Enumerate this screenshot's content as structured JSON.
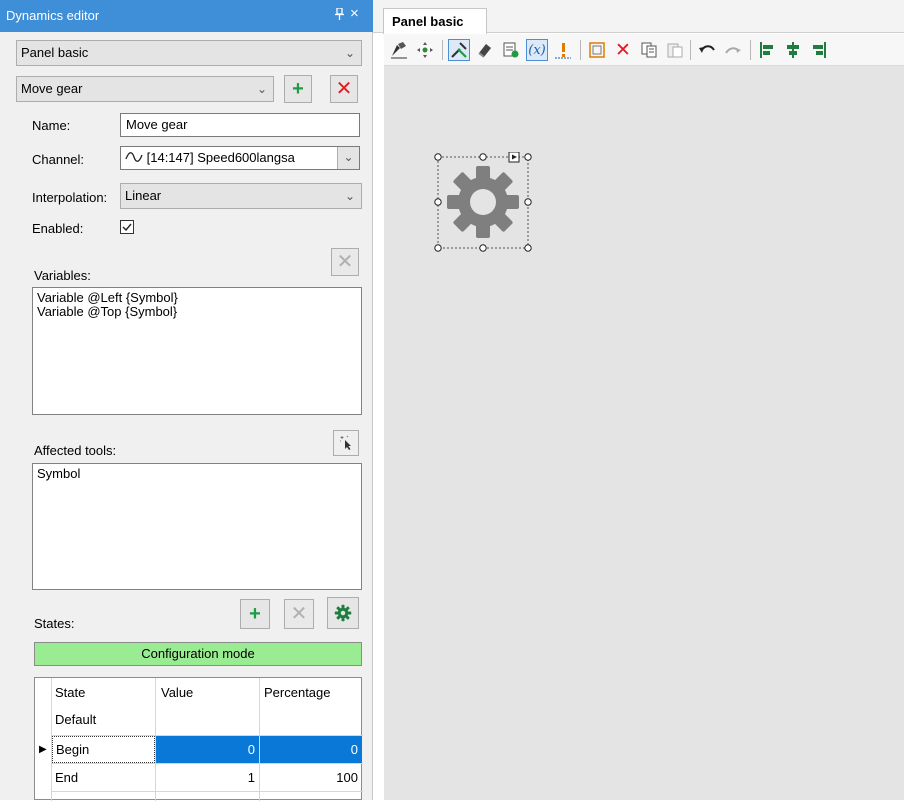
{
  "panel": {
    "title": "Dynamics editor",
    "pin_glyph": "⊥",
    "close_glyph": "×",
    "panel_selector": "Panel basic",
    "dynamic_selector": "Move gear"
  },
  "form": {
    "name_label": "Name:",
    "name_value": "Move gear",
    "channel_label": "Channel:",
    "channel_value": "[14:147] Speed600langsa",
    "interpolation_label": "Interpolation:",
    "interpolation_value": "Linear",
    "enabled_label": "Enabled:",
    "enabled_checked": true
  },
  "variables": {
    "label": "Variables:",
    "items": [
      "Variable @Left {Symbol}",
      "Variable @Top {Symbol}"
    ]
  },
  "affected_tools": {
    "label": "Affected tools:",
    "items": [
      "Symbol"
    ]
  },
  "states": {
    "label": "States:",
    "config_mode_label": "Configuration mode",
    "columns": [
      "State",
      "Value",
      "Percentage"
    ],
    "rows": [
      {
        "state": "Default",
        "value": "",
        "percentage": ""
      },
      {
        "state": "Begin",
        "value": "0",
        "percentage": "0",
        "selected": true
      },
      {
        "state": "End",
        "value": "1",
        "percentage": "100"
      }
    ]
  },
  "document": {
    "tab_label": "Panel basic"
  },
  "toolbar": {
    "items": [
      "edit-mode-icon",
      "move-icon",
      "tools-icon",
      "eraser-icon",
      "properties-icon",
      "variable-icon",
      "warning-icon",
      "frame-icon",
      "delete-icon",
      "copy-icon",
      "paste-icon",
      "undo-icon",
      "redo-icon",
      "align-left-icon",
      "align-center-icon",
      "align-right-icon"
    ]
  },
  "colors": {
    "header_blue": "#3e8ed8",
    "config_green": "#9aec92",
    "selection_blue": "#0a78d7",
    "canvas_grey": "#e4e4e4",
    "gear_grey": "#7f7f7f"
  }
}
